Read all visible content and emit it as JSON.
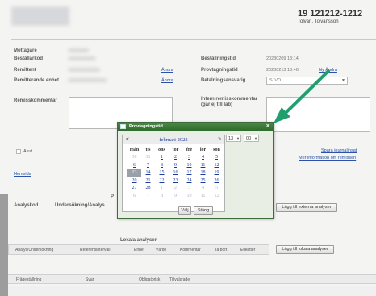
{
  "header": {
    "patient_id": "19 121212-1212",
    "patient_name": "Tolvan, Tolvansson"
  },
  "left_fields": [
    {
      "label": "Mottagare",
      "value": "xxxxxxxxx",
      "link": ""
    },
    {
      "label": "Beställarkod",
      "value": "xxxxxxxxxxxx",
      "link": ""
    },
    {
      "label": "Remittent",
      "value": "xxxxxxxxxxxxxx",
      "link": "Ändra"
    },
    {
      "label": "Remitterande enhet",
      "value": "xxxxxxxxxxxxxxxxx",
      "link": "Ändra"
    }
  ],
  "right_fields": {
    "order_time_label": "Beställningstid",
    "order_time_value": "20230209 13:14",
    "sample_time_label": "Provtagningstid",
    "sample_time_value": "20230213 13:46",
    "sample_time_link": "Ny Ändra",
    "payer_label": "Betalningsansvarig",
    "payer_value": "SJVD"
  },
  "comment_label": "Remisskommentar",
  "internal_comment_label": "Intern remisskommentar (går ej till lab)",
  "akut_label": "Akut",
  "journal_link": "Spara journalinsat",
  "info_link": "Mer information om remissen",
  "left_link": "Hemsida",
  "analyses_heading": "Analyskod",
  "analyses_col2": "Undersökning/Analys",
  "left_stub_letter": "P",
  "btn_external": "Lägg till externa analyser",
  "local_heading": "Lokala analyser",
  "local_columns": [
    "Analys/Undersökning",
    "Referensintervall",
    "Enhet",
    "Värde",
    "Kommentar",
    "Ta bort",
    "Etiketter"
  ],
  "btn_local": "Lägg till lokala analyser",
  "bottom_columns": [
    "Frågeställning",
    "Svar",
    "Obligatorisk",
    "Tillvalsrade"
  ],
  "dialog": {
    "title": "Provtagningstid",
    "close": "×",
    "month_label": "februari 2023",
    "prev": "«",
    "next": "»",
    "weekdays": [
      "mån",
      "tis",
      "ons",
      "tor",
      "fre",
      "lör",
      "sön"
    ],
    "weeks": [
      [
        "30",
        "31",
        "1",
        "2",
        "3",
        "4",
        "5"
      ],
      [
        "6",
        "7",
        "8",
        "9",
        "10",
        "11",
        "12"
      ],
      [
        "13",
        "14",
        "15",
        "16",
        "17",
        "18",
        "19"
      ],
      [
        "20",
        "21",
        "22",
        "23",
        "24",
        "25",
        "26"
      ],
      [
        "27",
        "28",
        "1",
        "2",
        "3",
        "4",
        "5"
      ],
      [
        "6",
        "7",
        "8",
        "9",
        "10",
        "11",
        "12"
      ]
    ],
    "selected_day": "13",
    "hour_value": "13",
    "minute_value": "00",
    "btn_select": "Välj",
    "btn_close": "Stäng"
  },
  "colors": {
    "arrow": "#1f9e6e",
    "dialog_title": "#3a7a36",
    "link": "#2a53a8"
  }
}
